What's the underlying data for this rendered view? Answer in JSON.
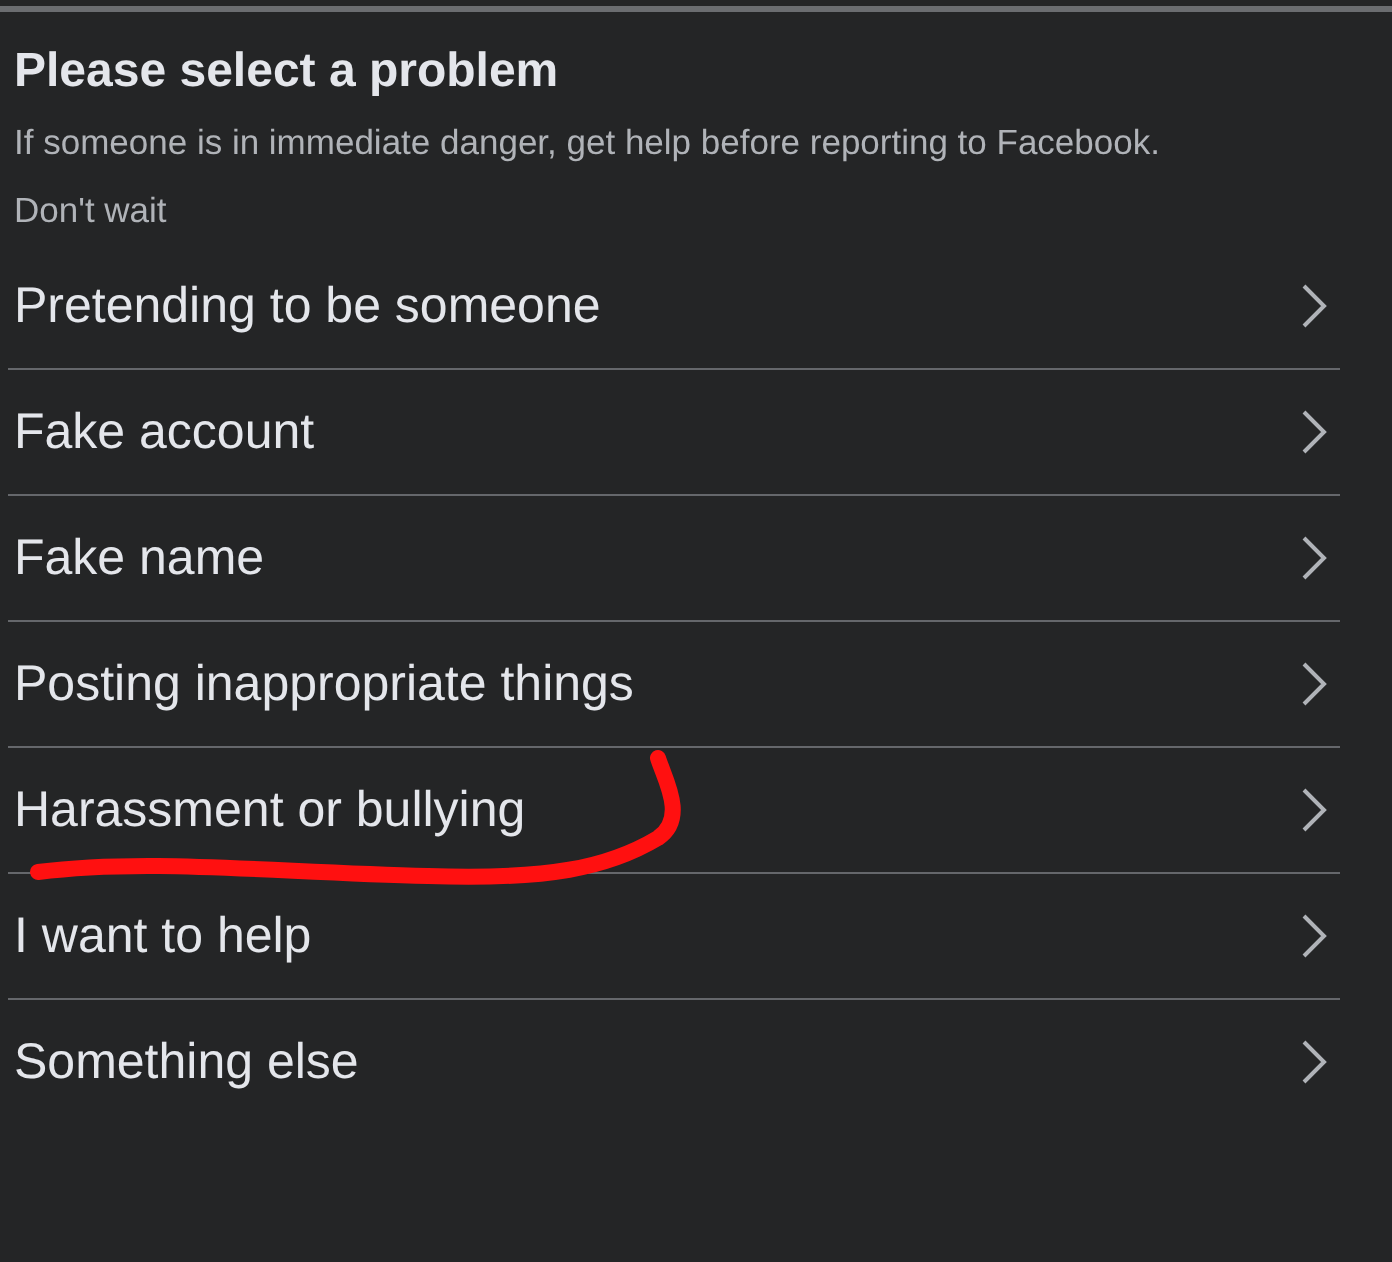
{
  "title": "Please select a problem",
  "subtitle": "If someone is in immediate danger, get help before reporting to Facebook. Don't wait",
  "options": [
    {
      "label": "Pretending to be someone",
      "marked": false
    },
    {
      "label": "Fake account",
      "marked": false
    },
    {
      "label": "Fake name",
      "marked": false
    },
    {
      "label": "Posting inappropriate things",
      "marked": false
    },
    {
      "label": "Harassment or bullying",
      "marked": true
    },
    {
      "label": "I want to help",
      "marked": false
    },
    {
      "label": "Something else",
      "marked": false
    }
  ]
}
